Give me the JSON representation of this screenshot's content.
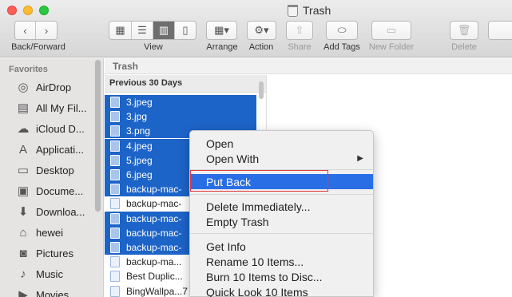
{
  "window": {
    "title": "Trash"
  },
  "toolbar": {
    "back_forward_label": "Back/Forward",
    "view_label": "View",
    "arrange_label": "Arrange",
    "action_label": "Action",
    "share_label": "Share",
    "add_tags_label": "Add Tags",
    "new_folder_label": "New Folder",
    "delete_label": "Delete",
    "active_view": "column"
  },
  "sidebar": {
    "header": "Favorites",
    "items": [
      {
        "label": "AirDrop",
        "icon": "airdrop-icon",
        "glyph": "◎"
      },
      {
        "label": "All My Fil...",
        "icon": "all-files-icon",
        "glyph": "▤"
      },
      {
        "label": "iCloud D...",
        "icon": "cloud-icon",
        "glyph": "☁"
      },
      {
        "label": "Applicati...",
        "icon": "applications-icon",
        "glyph": "A"
      },
      {
        "label": "Desktop",
        "icon": "desktop-icon",
        "glyph": "▭"
      },
      {
        "label": "Docume...",
        "icon": "documents-icon",
        "glyph": "▣"
      },
      {
        "label": "Downloa...",
        "icon": "download-icon",
        "glyph": "⬇"
      },
      {
        "label": "hewei",
        "icon": "home-icon",
        "glyph": "⌂"
      },
      {
        "label": "Pictures",
        "icon": "camera-icon",
        "glyph": "◙"
      },
      {
        "label": "Music",
        "icon": "music-icon",
        "glyph": "♪"
      },
      {
        "label": "Movies",
        "icon": "movie-icon",
        "glyph": "▶"
      }
    ]
  },
  "path": {
    "label": "Trash"
  },
  "file_list": {
    "section": "Previous 30 Days",
    "rows": [
      {
        "name": "3.jpeg",
        "selected": true
      },
      {
        "name": "3.jpg",
        "selected": true
      },
      {
        "name": "3.png",
        "selected": true
      },
      {
        "name": "4.jpeg",
        "selected": true
      },
      {
        "name": "5.jpeg",
        "selected": true
      },
      {
        "name": "6.jpeg",
        "selected": true
      },
      {
        "name": "backup-mac-",
        "selected": true
      },
      {
        "name": "backup-mac-",
        "selected": false
      },
      {
        "name": "backup-mac-",
        "selected": true
      },
      {
        "name": "backup-mac-",
        "selected": true
      },
      {
        "name": "backup-mac-",
        "selected": true
      },
      {
        "name": "backup-ma...",
        "selected": false
      },
      {
        "name": "Best Duplic...",
        "selected": false
      },
      {
        "name": "BingWallpa...7",
        "selected": false
      }
    ]
  },
  "context_menu": {
    "open": "Open",
    "open_with": "Open With",
    "put_back": "Put Back",
    "delete_immediately": "Delete Immediately...",
    "empty_trash": "Empty Trash",
    "get_info": "Get Info",
    "rename": "Rename 10 Items...",
    "burn": "Burn 10 Items to Disc...",
    "quick_look": "Quick Look 10 Items",
    "highlighted": "Put Back",
    "highlight_color": "#2a6ee6",
    "annotation_color": "#e3393b"
  },
  "colors": {
    "selection": "#1d64c8"
  }
}
